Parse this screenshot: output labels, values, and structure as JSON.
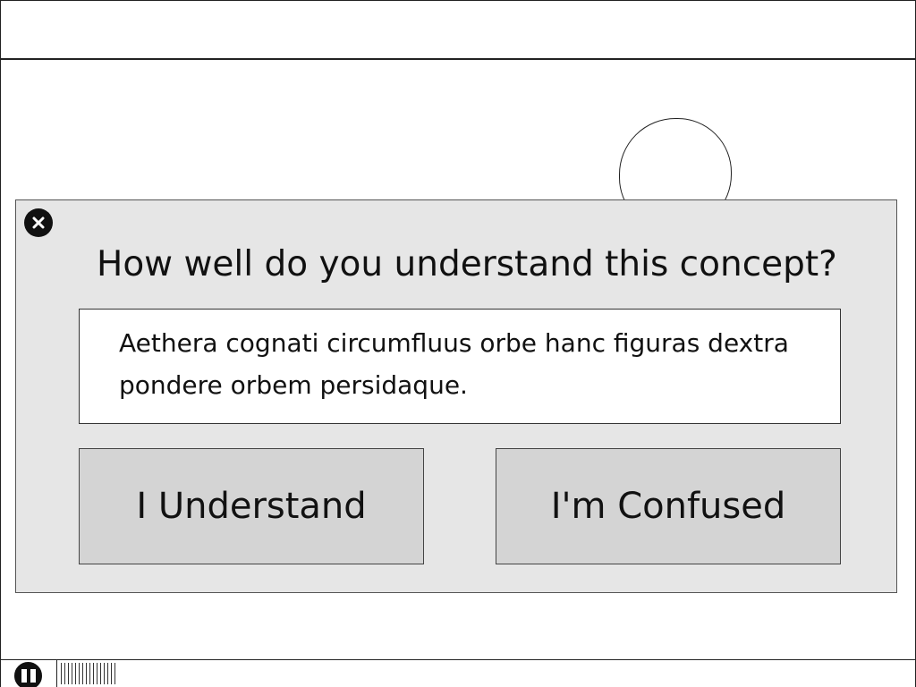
{
  "dialog": {
    "question": "How well do you understand this concept?",
    "concept_text": "Aethera cognati circumfluus orbe hanc figuras dextra pondere orbem persidaque.",
    "buttons": {
      "understand": "I Understand",
      "confused": "I'm Confused"
    },
    "close_icon": "close-icon"
  },
  "player": {
    "pause_icon": "pause-icon"
  }
}
